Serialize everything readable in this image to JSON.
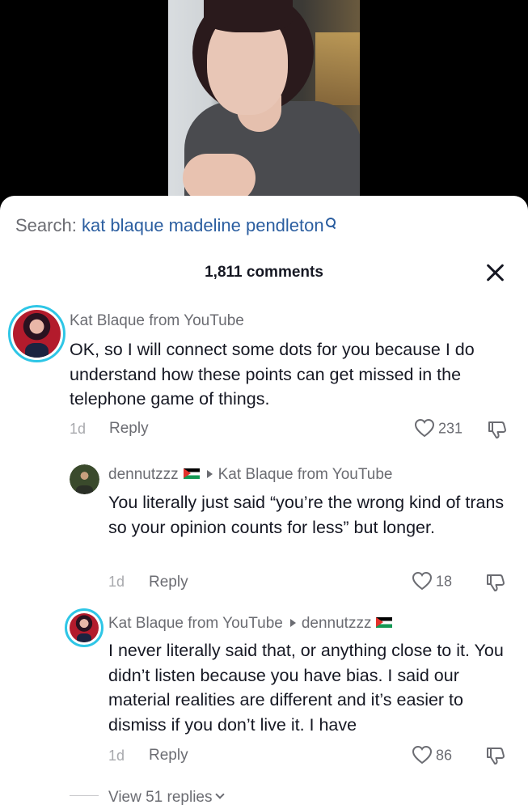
{
  "search": {
    "prefix": "Search:",
    "query": "kat blaque madeline pendleton",
    "icon": "search-icon"
  },
  "header": {
    "comments_count": "1,811 comments",
    "close_icon": "close-icon"
  },
  "comments": [
    {
      "author": "Kat Blaque from YouTube",
      "reply_to": "",
      "text": "OK, so I will connect some dots for you because I do understand how these points can get missed in the telephone game of things.",
      "time": "1d",
      "reply_label": "Reply",
      "likes": "231"
    },
    {
      "author": "dennutzzz",
      "reply_to": "Kat Blaque from YouTube",
      "text": "You literally just said “you’re the wrong kind of trans so your opinion counts for less” but longer.",
      "time": "1d",
      "reply_label": "Reply",
      "likes": "18"
    },
    {
      "author": "Kat Blaque from YouTube",
      "reply_to": "dennutzzz",
      "text": "I never literally said that, or anything close to it. You didn’t listen because you have bias. I said our material realities are different and it’s easier to dismiss if you don’t live it. I have",
      "time": "1d",
      "reply_label": "Reply",
      "likes": "86"
    }
  ],
  "view_replies": "View 51 replies",
  "colors": {
    "link_blue": "#2b5ea0",
    "ring_cyan": "#2ec6e6",
    "text": "#161823",
    "muted": "#6b6c72"
  }
}
